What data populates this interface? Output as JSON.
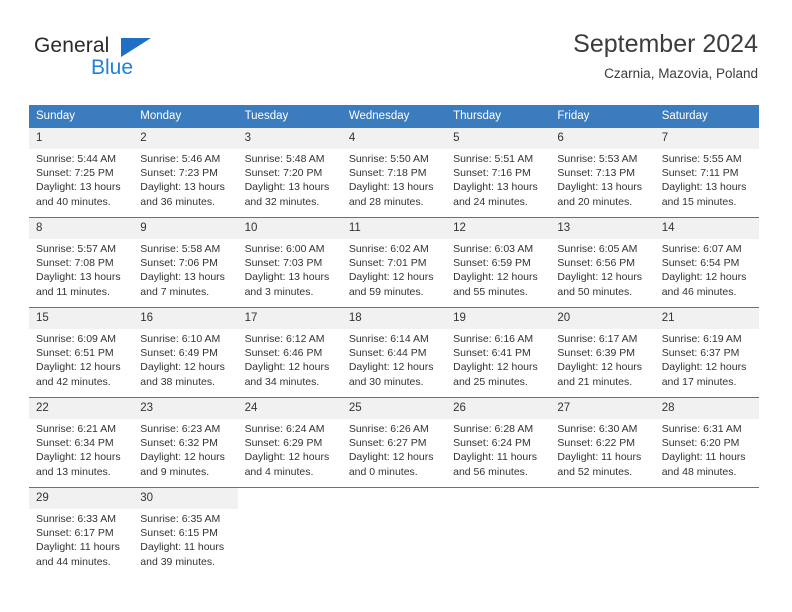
{
  "brand": {
    "name_part1": "General",
    "name_part2": "Blue",
    "triangle_color": "#1f6fc4",
    "blue_color": "#1f82d8"
  },
  "header": {
    "title": "September 2024",
    "subtitle": "Czarnia, Mazovia, Poland"
  },
  "theme": {
    "header_row_bg": "#3b7cbf",
    "daynum_bg": "#f1f1f1",
    "text_color": "#333333"
  },
  "weekdays": [
    "Sunday",
    "Monday",
    "Tuesday",
    "Wednesday",
    "Thursday",
    "Friday",
    "Saturday"
  ],
  "weeks": [
    [
      {
        "day": "1",
        "sunrise": "Sunrise: 5:44 AM",
        "sunset": "Sunset: 7:25 PM",
        "daylight1": "Daylight: 13 hours",
        "daylight2": "and 40 minutes."
      },
      {
        "day": "2",
        "sunrise": "Sunrise: 5:46 AM",
        "sunset": "Sunset: 7:23 PM",
        "daylight1": "Daylight: 13 hours",
        "daylight2": "and 36 minutes."
      },
      {
        "day": "3",
        "sunrise": "Sunrise: 5:48 AM",
        "sunset": "Sunset: 7:20 PM",
        "daylight1": "Daylight: 13 hours",
        "daylight2": "and 32 minutes."
      },
      {
        "day": "4",
        "sunrise": "Sunrise: 5:50 AM",
        "sunset": "Sunset: 7:18 PM",
        "daylight1": "Daylight: 13 hours",
        "daylight2": "and 28 minutes."
      },
      {
        "day": "5",
        "sunrise": "Sunrise: 5:51 AM",
        "sunset": "Sunset: 7:16 PM",
        "daylight1": "Daylight: 13 hours",
        "daylight2": "and 24 minutes."
      },
      {
        "day": "6",
        "sunrise": "Sunrise: 5:53 AM",
        "sunset": "Sunset: 7:13 PM",
        "daylight1": "Daylight: 13 hours",
        "daylight2": "and 20 minutes."
      },
      {
        "day": "7",
        "sunrise": "Sunrise: 5:55 AM",
        "sunset": "Sunset: 7:11 PM",
        "daylight1": "Daylight: 13 hours",
        "daylight2": "and 15 minutes."
      }
    ],
    [
      {
        "day": "8",
        "sunrise": "Sunrise: 5:57 AM",
        "sunset": "Sunset: 7:08 PM",
        "daylight1": "Daylight: 13 hours",
        "daylight2": "and 11 minutes."
      },
      {
        "day": "9",
        "sunrise": "Sunrise: 5:58 AM",
        "sunset": "Sunset: 7:06 PM",
        "daylight1": "Daylight: 13 hours",
        "daylight2": "and 7 minutes."
      },
      {
        "day": "10",
        "sunrise": "Sunrise: 6:00 AM",
        "sunset": "Sunset: 7:03 PM",
        "daylight1": "Daylight: 13 hours",
        "daylight2": "and 3 minutes."
      },
      {
        "day": "11",
        "sunrise": "Sunrise: 6:02 AM",
        "sunset": "Sunset: 7:01 PM",
        "daylight1": "Daylight: 12 hours",
        "daylight2": "and 59 minutes."
      },
      {
        "day": "12",
        "sunrise": "Sunrise: 6:03 AM",
        "sunset": "Sunset: 6:59 PM",
        "daylight1": "Daylight: 12 hours",
        "daylight2": "and 55 minutes."
      },
      {
        "day": "13",
        "sunrise": "Sunrise: 6:05 AM",
        "sunset": "Sunset: 6:56 PM",
        "daylight1": "Daylight: 12 hours",
        "daylight2": "and 50 minutes."
      },
      {
        "day": "14",
        "sunrise": "Sunrise: 6:07 AM",
        "sunset": "Sunset: 6:54 PM",
        "daylight1": "Daylight: 12 hours",
        "daylight2": "and 46 minutes."
      }
    ],
    [
      {
        "day": "15",
        "sunrise": "Sunrise: 6:09 AM",
        "sunset": "Sunset: 6:51 PM",
        "daylight1": "Daylight: 12 hours",
        "daylight2": "and 42 minutes."
      },
      {
        "day": "16",
        "sunrise": "Sunrise: 6:10 AM",
        "sunset": "Sunset: 6:49 PM",
        "daylight1": "Daylight: 12 hours",
        "daylight2": "and 38 minutes."
      },
      {
        "day": "17",
        "sunrise": "Sunrise: 6:12 AM",
        "sunset": "Sunset: 6:46 PM",
        "daylight1": "Daylight: 12 hours",
        "daylight2": "and 34 minutes."
      },
      {
        "day": "18",
        "sunrise": "Sunrise: 6:14 AM",
        "sunset": "Sunset: 6:44 PM",
        "daylight1": "Daylight: 12 hours",
        "daylight2": "and 30 minutes."
      },
      {
        "day": "19",
        "sunrise": "Sunrise: 6:16 AM",
        "sunset": "Sunset: 6:41 PM",
        "daylight1": "Daylight: 12 hours",
        "daylight2": "and 25 minutes."
      },
      {
        "day": "20",
        "sunrise": "Sunrise: 6:17 AM",
        "sunset": "Sunset: 6:39 PM",
        "daylight1": "Daylight: 12 hours",
        "daylight2": "and 21 minutes."
      },
      {
        "day": "21",
        "sunrise": "Sunrise: 6:19 AM",
        "sunset": "Sunset: 6:37 PM",
        "daylight1": "Daylight: 12 hours",
        "daylight2": "and 17 minutes."
      }
    ],
    [
      {
        "day": "22",
        "sunrise": "Sunrise: 6:21 AM",
        "sunset": "Sunset: 6:34 PM",
        "daylight1": "Daylight: 12 hours",
        "daylight2": "and 13 minutes."
      },
      {
        "day": "23",
        "sunrise": "Sunrise: 6:23 AM",
        "sunset": "Sunset: 6:32 PM",
        "daylight1": "Daylight: 12 hours",
        "daylight2": "and 9 minutes."
      },
      {
        "day": "24",
        "sunrise": "Sunrise: 6:24 AM",
        "sunset": "Sunset: 6:29 PM",
        "daylight1": "Daylight: 12 hours",
        "daylight2": "and 4 minutes."
      },
      {
        "day": "25",
        "sunrise": "Sunrise: 6:26 AM",
        "sunset": "Sunset: 6:27 PM",
        "daylight1": "Daylight: 12 hours",
        "daylight2": "and 0 minutes."
      },
      {
        "day": "26",
        "sunrise": "Sunrise: 6:28 AM",
        "sunset": "Sunset: 6:24 PM",
        "daylight1": "Daylight: 11 hours",
        "daylight2": "and 56 minutes."
      },
      {
        "day": "27",
        "sunrise": "Sunrise: 6:30 AM",
        "sunset": "Sunset: 6:22 PM",
        "daylight1": "Daylight: 11 hours",
        "daylight2": "and 52 minutes."
      },
      {
        "day": "28",
        "sunrise": "Sunrise: 6:31 AM",
        "sunset": "Sunset: 6:20 PM",
        "daylight1": "Daylight: 11 hours",
        "daylight2": "and 48 minutes."
      }
    ],
    [
      {
        "day": "29",
        "sunrise": "Sunrise: 6:33 AM",
        "sunset": "Sunset: 6:17 PM",
        "daylight1": "Daylight: 11 hours",
        "daylight2": "and 44 minutes."
      },
      {
        "day": "30",
        "sunrise": "Sunrise: 6:35 AM",
        "sunset": "Sunset: 6:15 PM",
        "daylight1": "Daylight: 11 hours",
        "daylight2": "and 39 minutes."
      },
      {
        "day": "",
        "sunrise": "",
        "sunset": "",
        "daylight1": "",
        "daylight2": ""
      },
      {
        "day": "",
        "sunrise": "",
        "sunset": "",
        "daylight1": "",
        "daylight2": ""
      },
      {
        "day": "",
        "sunrise": "",
        "sunset": "",
        "daylight1": "",
        "daylight2": ""
      },
      {
        "day": "",
        "sunrise": "",
        "sunset": "",
        "daylight1": "",
        "daylight2": ""
      },
      {
        "day": "",
        "sunrise": "",
        "sunset": "",
        "daylight1": "",
        "daylight2": ""
      }
    ]
  ]
}
